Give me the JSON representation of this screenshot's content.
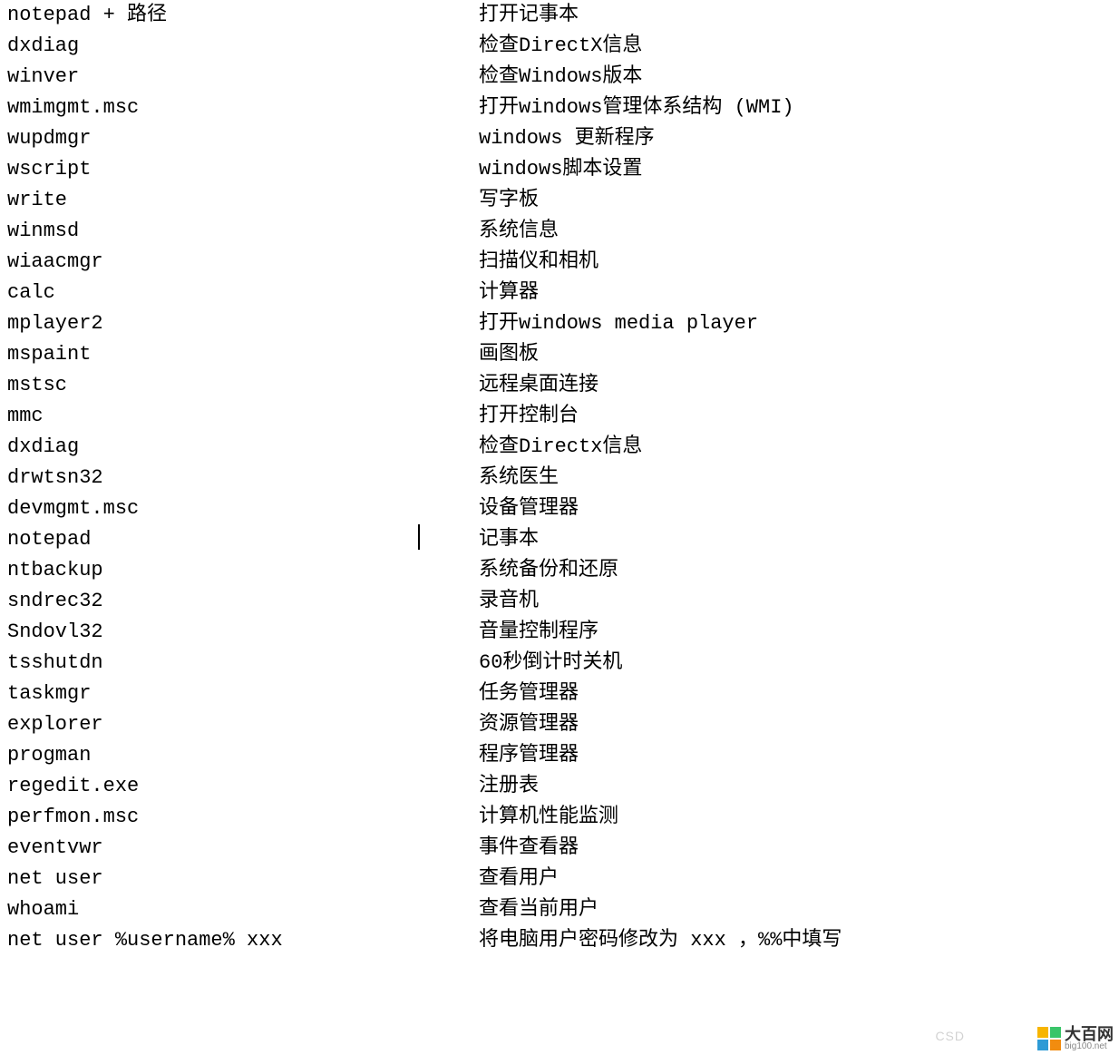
{
  "commands": [
    {
      "cmd": "notepad + 路径",
      "desc": "打开记事本"
    },
    {
      "cmd": "dxdiag",
      "desc": "检查DirectX信息"
    },
    {
      "cmd": "winver",
      "desc": "检查Windows版本"
    },
    {
      "cmd": "wmimgmt.msc",
      "desc": "打开windows管理体系结构 (WMI)"
    },
    {
      "cmd": "wupdmgr",
      "desc": "windows 更新程序"
    },
    {
      "cmd": "wscript",
      "desc": "windows脚本设置"
    },
    {
      "cmd": "write",
      "desc": "写字板"
    },
    {
      "cmd": "winmsd",
      "desc": "系统信息"
    },
    {
      "cmd": "wiaacmgr",
      "desc": "扫描仪和相机"
    },
    {
      "cmd": "calc",
      "desc": "计算器"
    },
    {
      "cmd": "mplayer2",
      "desc": "打开windows media player"
    },
    {
      "cmd": "mspaint",
      "desc": "画图板"
    },
    {
      "cmd": "mstsc",
      "desc": "远程桌面连接"
    },
    {
      "cmd": "mmc",
      "desc": "打开控制台"
    },
    {
      "cmd": "dxdiag",
      "desc": "检查Directx信息"
    },
    {
      "cmd": "drwtsn32",
      "desc": "系统医生"
    },
    {
      "cmd": "devmgmt.msc",
      "desc": "设备管理器"
    },
    {
      "cmd": "notepad",
      "desc": "记事本"
    },
    {
      "cmd": "ntbackup",
      "desc": "系统备份和还原"
    },
    {
      "cmd": "sndrec32",
      "desc": "录音机"
    },
    {
      "cmd": "Sndovl32",
      "desc": "音量控制程序"
    },
    {
      "cmd": "tsshutdn",
      "desc": "60秒倒计时关机"
    },
    {
      "cmd": "taskmgr",
      "desc": "任务管理器"
    },
    {
      "cmd": "explorer",
      "desc": "资源管理器"
    },
    {
      "cmd": "progman",
      "desc": "程序管理器"
    },
    {
      "cmd": "regedit.exe",
      "desc": "注册表"
    },
    {
      "cmd": "perfmon.msc",
      "desc": "计算机性能监测"
    },
    {
      "cmd": "eventvwr",
      "desc": "事件查看器"
    },
    {
      "cmd": "net user",
      "desc": "查看用户"
    },
    {
      "cmd": "whoami",
      "desc": "查看当前用户"
    },
    {
      "cmd": "net user %username% xxx",
      "desc": "将电脑用户密码修改为 xxx ，%%中填写"
    }
  ],
  "watermarks": {
    "csd": "CSD",
    "logo_text": "大百网",
    "logo_sub": "big100.net"
  }
}
